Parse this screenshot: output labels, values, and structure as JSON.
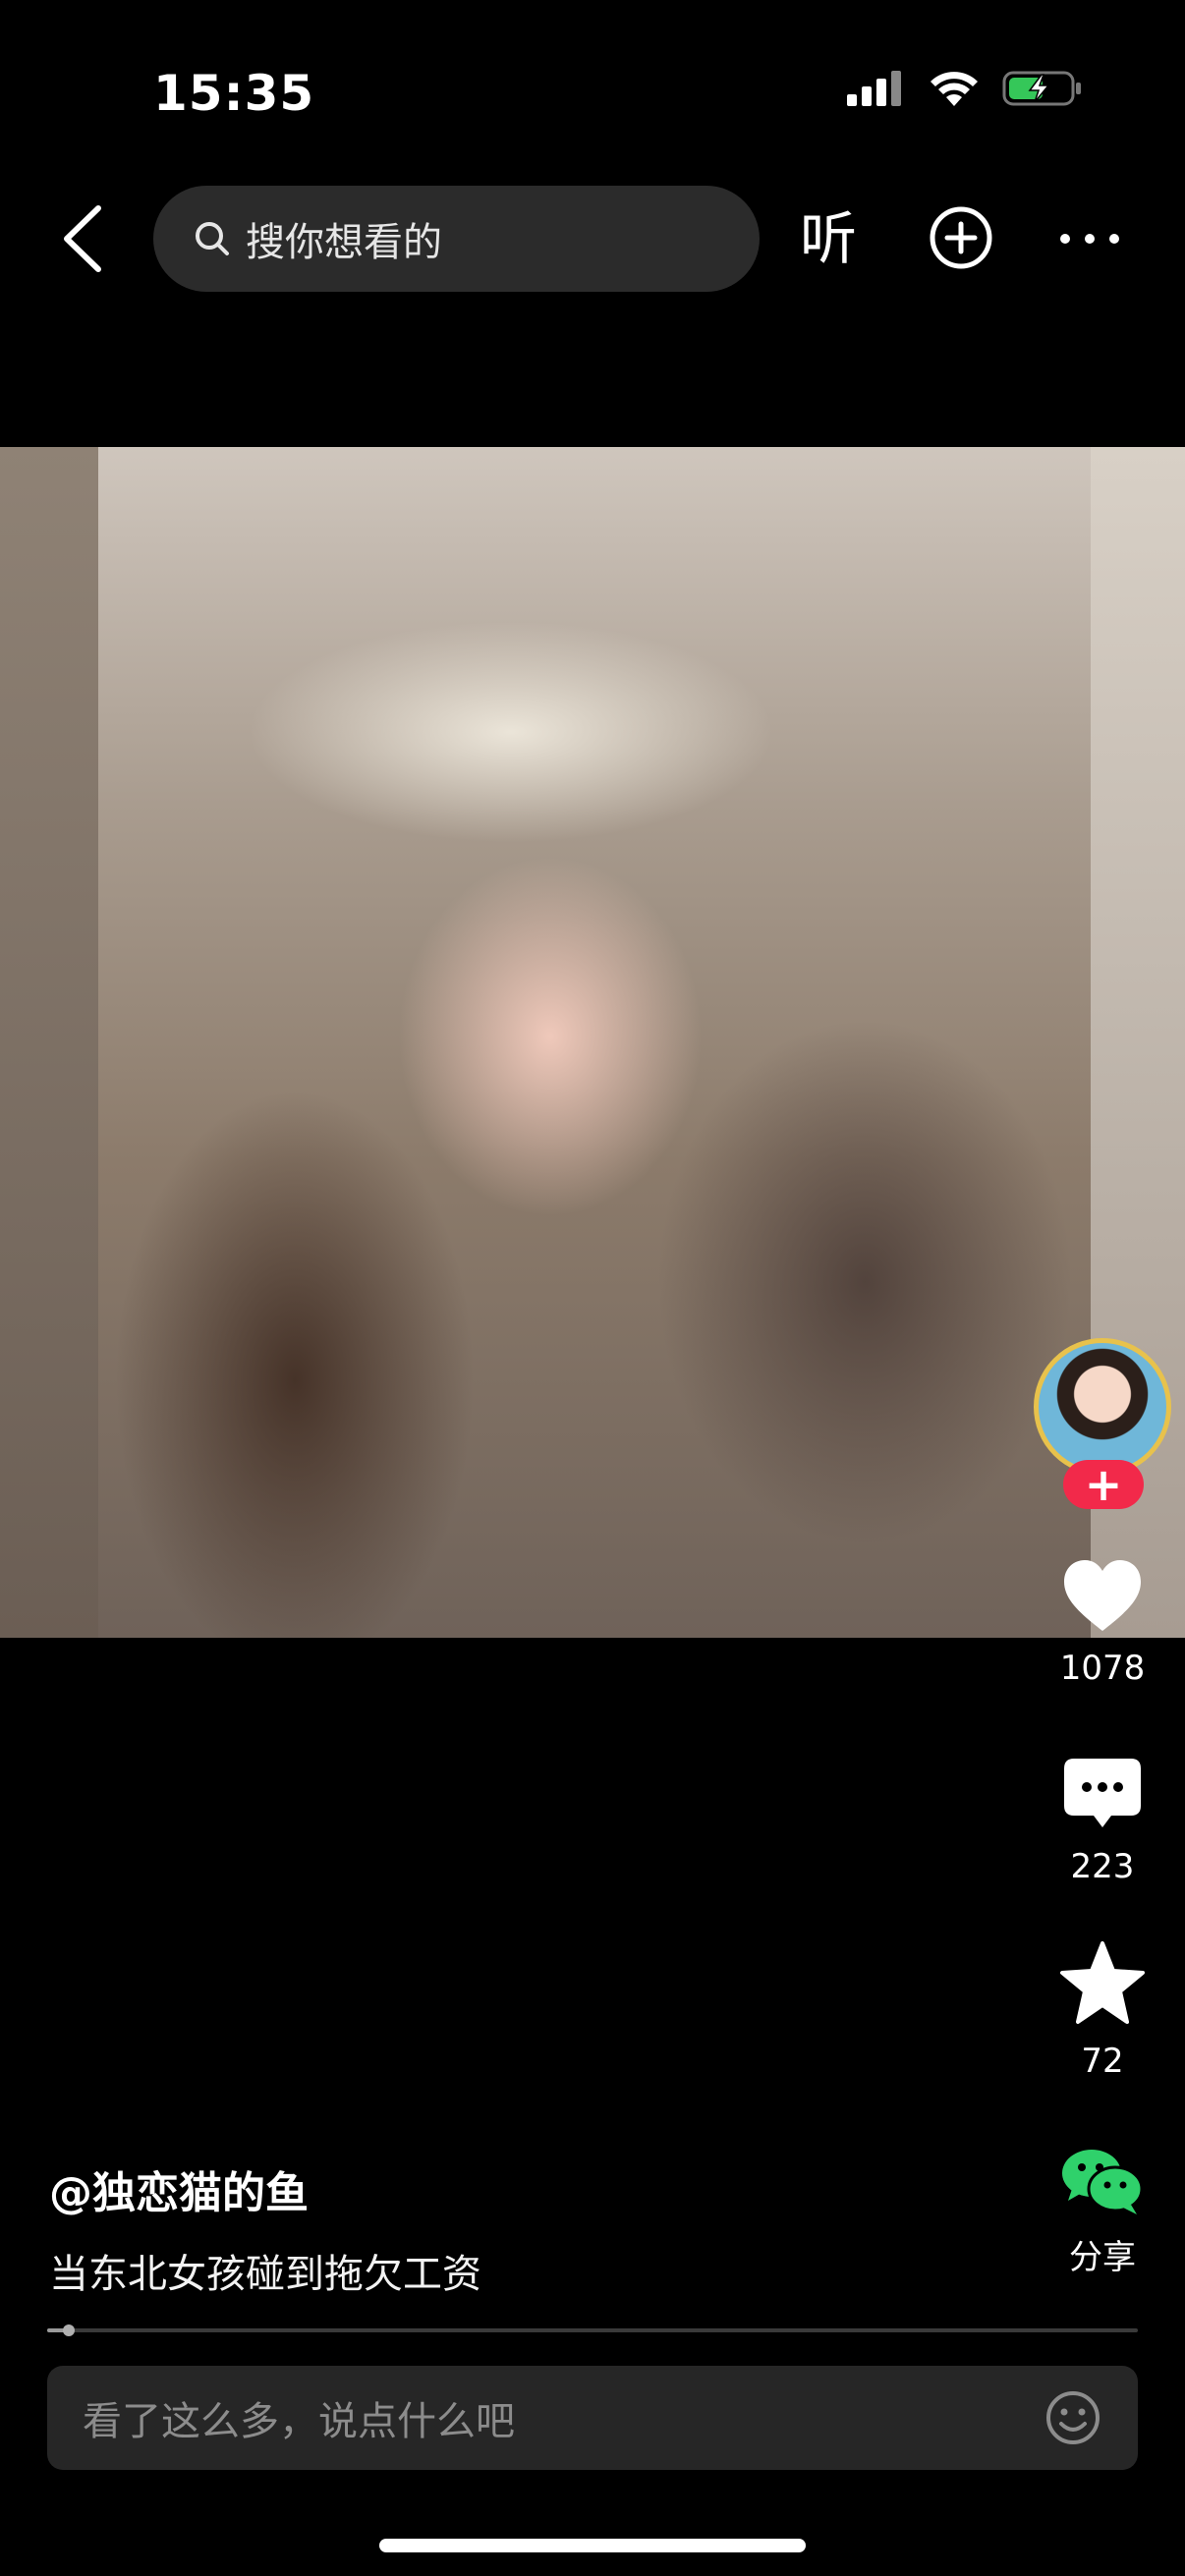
{
  "status_bar": {
    "time": "15:35"
  },
  "top_bar": {
    "search_placeholder": "搜你想看的",
    "listen_label": "听"
  },
  "author": {
    "name": "@独恋猫的鱼"
  },
  "caption": "当东北女孩碰到拖欠工资",
  "actions": {
    "likes": "1078",
    "comments": "223",
    "favorites": "72",
    "share_label": "分享"
  },
  "progress": {
    "played_fraction": 0.02
  },
  "comment_input": {
    "placeholder": "看了这么多，说点什么吧"
  },
  "follow_label": "+",
  "colors": {
    "follow_red": "#f2294a",
    "wechat_green": "#2fd16b",
    "background": "#000000"
  }
}
